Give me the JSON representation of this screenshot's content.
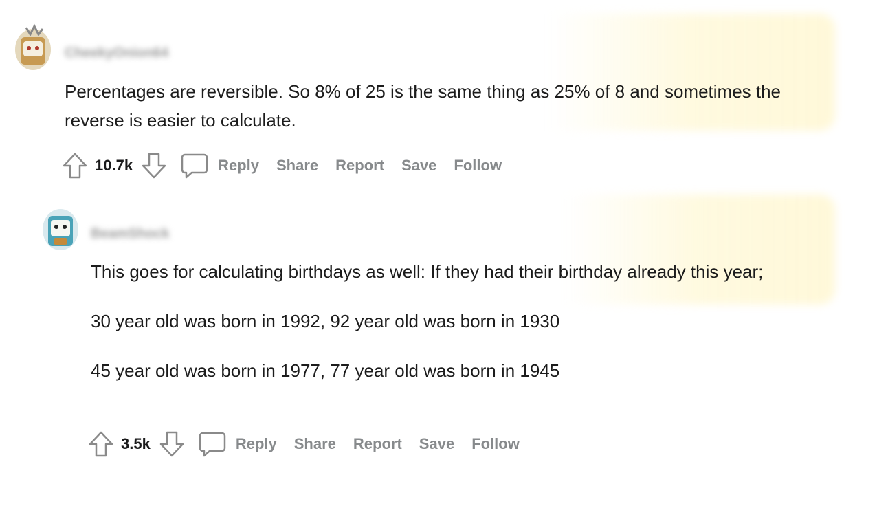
{
  "comments": [
    {
      "username": "CheekyOnion64",
      "body": [
        "Percentages are reversible. So 8% of 25 is the same thing as 25% of 8 and sometimes the reverse is easier to calculate."
      ],
      "score": "10.7k",
      "actions": {
        "reply": "Reply",
        "share": "Share",
        "report": "Report",
        "save": "Save",
        "follow": "Follow"
      }
    },
    {
      "username": "BeamShock",
      "body": [
        "This goes for calculating birthdays as well: If they had their birthday already this year;",
        "30 year old was born in 1992, 92 year old was born in 1930",
        "45 year old was born in 1977, 77 year old was born in 1945"
      ],
      "score": "3.5k",
      "actions": {
        "reply": "Reply",
        "share": "Share",
        "report": "Report",
        "save": "Save",
        "follow": "Follow"
      }
    }
  ],
  "icons": {
    "upvote": "upvote-arrow-icon",
    "downvote": "downvote-arrow-icon",
    "reply": "speech-bubble-icon"
  }
}
